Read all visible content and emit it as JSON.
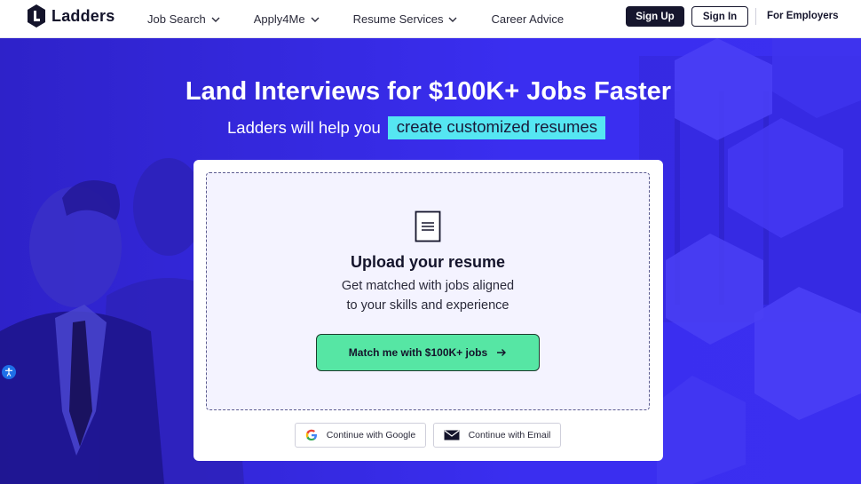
{
  "header": {
    "logo_text": "Ladders",
    "nav": [
      {
        "label": "Job Search",
        "has_dropdown": true
      },
      {
        "label": "Apply4Me",
        "has_dropdown": true
      },
      {
        "label": "Resume Services",
        "has_dropdown": true
      },
      {
        "label": "Career Advice",
        "has_dropdown": false
      }
    ],
    "sign_up": "Sign Up",
    "sign_in": "Sign In",
    "employers": "For Employers"
  },
  "hero": {
    "headline": "Land Interviews for $100K+ Jobs Faster",
    "subline": "Ladders will help you",
    "highlight": "create customized resumes",
    "colors": {
      "background": "#3b2ff0",
      "highlight": "#55e6f2",
      "cta": "#56e6a4"
    }
  },
  "upload": {
    "icon": "document-icon",
    "title": "Upload your resume",
    "desc_line1": "Get matched with jobs aligned",
    "desc_line2": "to your skills and experience",
    "cta": "Match me with $100K+ jobs"
  },
  "social": {
    "google": "Continue with Google",
    "email": "Continue with Email"
  }
}
